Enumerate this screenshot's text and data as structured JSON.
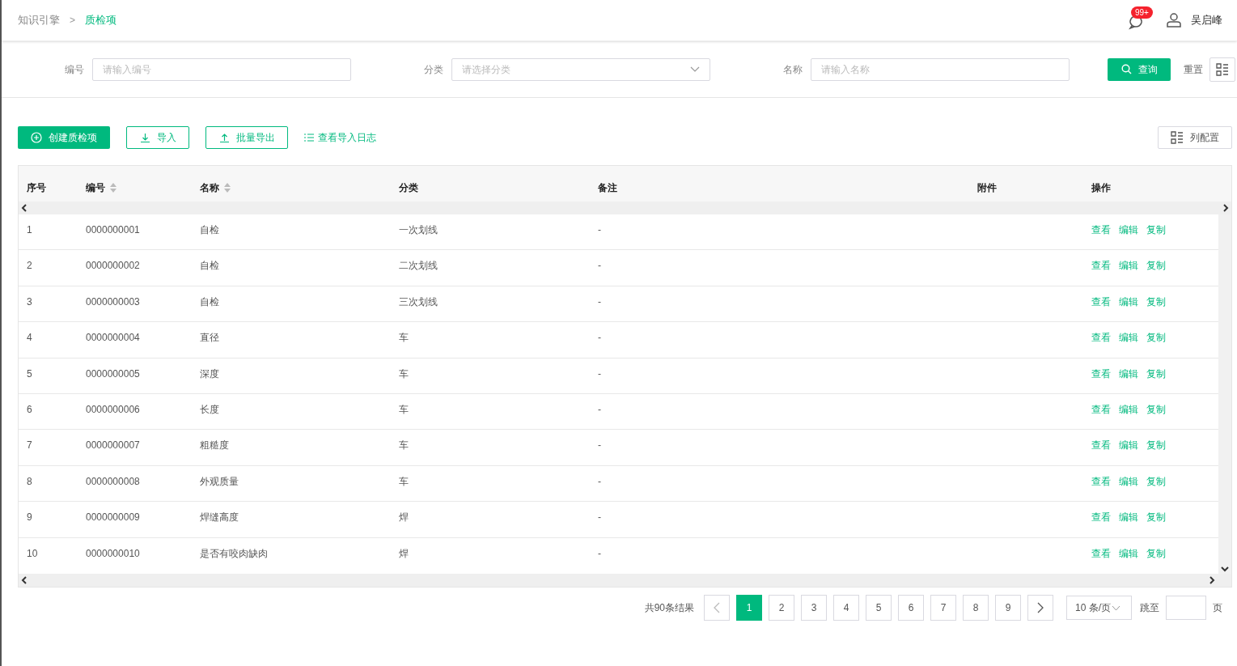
{
  "breadcrumb": [
    "知识引擎",
    "质检项"
  ],
  "breadcrumb_separator": ">",
  "header": {
    "notification_badge": "99+",
    "user_name": "吴启峰"
  },
  "filters": [
    {
      "label": "编号",
      "placeholder": "请输入编号",
      "kind": "text"
    },
    {
      "label": "分类",
      "placeholder": "请选择分类",
      "kind": "select"
    },
    {
      "label": "名称",
      "placeholder": "请输入名称",
      "kind": "text"
    }
  ],
  "filter_buttons": {
    "search": "查询",
    "reset": "重置"
  },
  "toolbar": {
    "create": "创建质检项",
    "import": "导入",
    "export": "批量导出",
    "import_log": "查看导入日志",
    "column_config": "列配置"
  },
  "table": {
    "columns": [
      {
        "label": "序号",
        "sortable": false
      },
      {
        "label": "编号",
        "sortable": true
      },
      {
        "label": "名称",
        "sortable": true
      },
      {
        "label": "分类",
        "sortable": false
      },
      {
        "label": "备注",
        "sortable": false
      },
      {
        "label": "附件",
        "sortable": false
      },
      {
        "label": "操作",
        "sortable": false
      }
    ],
    "rows": [
      {
        "index": "1",
        "code": "0000000001",
        "name": "自检",
        "category": "一次划线",
        "note": "-",
        "actions": [
          "查看",
          "编辑",
          "复制"
        ]
      },
      {
        "index": "2",
        "code": "0000000002",
        "name": "自检",
        "category": "二次划线",
        "note": "-",
        "actions": [
          "查看",
          "编辑",
          "复制"
        ]
      },
      {
        "index": "3",
        "code": "0000000003",
        "name": "自检",
        "category": "三次划线",
        "note": "-",
        "actions": [
          "查看",
          "编辑",
          "复制"
        ]
      },
      {
        "index": "4",
        "code": "0000000004",
        "name": "直径",
        "category": "车",
        "note": "-",
        "actions": [
          "查看",
          "编辑",
          "复制"
        ]
      },
      {
        "index": "5",
        "code": "0000000005",
        "name": "深度",
        "category": "车",
        "note": "-",
        "actions": [
          "查看",
          "编辑",
          "复制"
        ]
      },
      {
        "index": "6",
        "code": "0000000006",
        "name": "长度",
        "category": "车",
        "note": "-",
        "actions": [
          "查看",
          "编辑",
          "复制"
        ]
      },
      {
        "index": "7",
        "code": "0000000007",
        "name": "粗糙度",
        "category": "车",
        "note": "-",
        "actions": [
          "查看",
          "编辑",
          "复制"
        ]
      },
      {
        "index": "8",
        "code": "0000000008",
        "name": "外观质量",
        "category": "车",
        "note": "-",
        "actions": [
          "查看",
          "编辑",
          "复制"
        ]
      },
      {
        "index": "9",
        "code": "0000000009",
        "name": "焊缝高度",
        "category": "焊",
        "note": "-",
        "actions": [
          "查看",
          "编辑",
          "复制"
        ]
      },
      {
        "index": "10",
        "code": "0000000010",
        "name": "是否有咬肉缺肉",
        "category": "焊",
        "note": "-",
        "actions": [
          "查看",
          "编辑",
          "复制"
        ]
      }
    ]
  },
  "pagination": {
    "total": "共90条结果",
    "pages": [
      {
        "label": "1",
        "selected": true
      },
      {
        "label": "2",
        "selected": false
      },
      {
        "label": "3",
        "selected": false
      },
      {
        "label": "4",
        "selected": false
      },
      {
        "label": "5",
        "selected": false
      },
      {
        "label": "6",
        "selected": false
      },
      {
        "label": "7",
        "selected": false
      },
      {
        "label": "8",
        "selected": false
      },
      {
        "label": "9",
        "selected": false
      }
    ],
    "page_size": "10 条/页",
    "jump_label": "跳至",
    "page_suffix": "页"
  }
}
